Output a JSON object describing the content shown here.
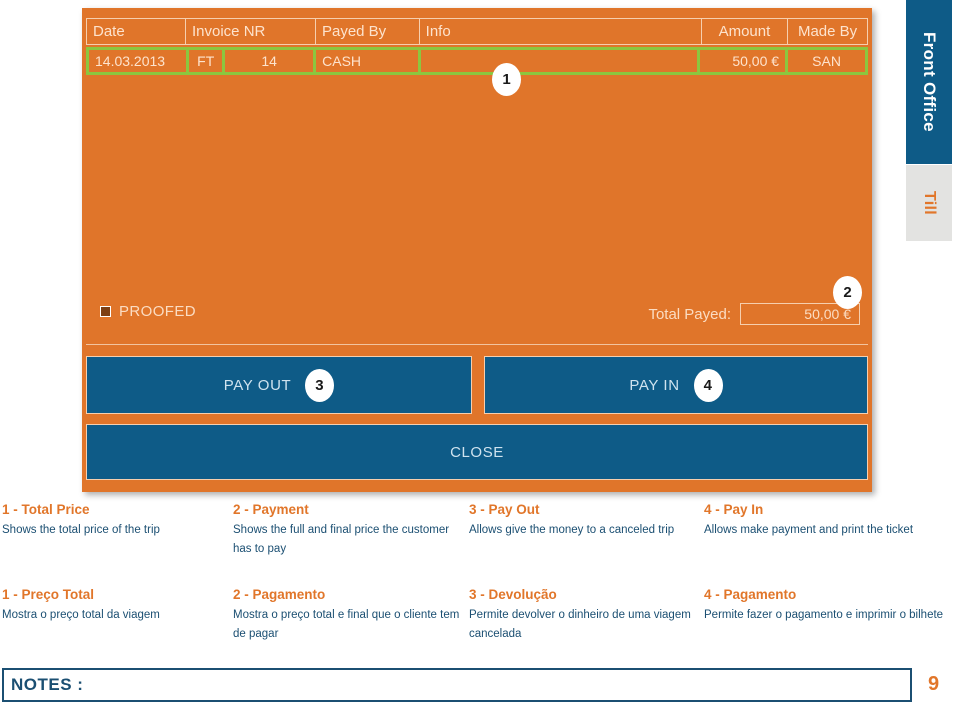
{
  "side_tabs": [
    {
      "label": "Front Office",
      "state": "active"
    },
    {
      "label": "Till",
      "state": "inactive"
    }
  ],
  "app": {
    "table": {
      "columns": [
        {
          "key": "date",
          "label": "Date"
        },
        {
          "key": "invoice",
          "label": "Invoice NR"
        },
        {
          "key": "payed_by",
          "label": "Payed By"
        },
        {
          "key": "info",
          "label": "Info"
        },
        {
          "key": "amount",
          "label": "Amount"
        },
        {
          "key": "made_by",
          "label": "Made By"
        }
      ],
      "rows": [
        {
          "date": "14.03.2013",
          "invoice_type": "FT",
          "invoice_nr": "14",
          "payed_by": "CASH",
          "info": "",
          "amount": "50,00 €",
          "made_by": "SAN"
        }
      ]
    },
    "proofed_label": "PROOFED",
    "total_payed_label": "Total Payed:",
    "total_payed_value": "50,00 €",
    "buttons": {
      "pay_out": "PAY OUT",
      "pay_in": "PAY IN",
      "close": "CLOSE"
    },
    "badges": {
      "total_price": "1",
      "payment": "2",
      "pay_out": "3",
      "pay_in": "4"
    }
  },
  "captions_en": [
    {
      "title": "1 - Total Price",
      "text": "Shows the total price of the trip"
    },
    {
      "title": "2 -  Payment",
      "text": "Shows the full and final price the customer has to pay"
    },
    {
      "title": "3 - Pay Out",
      "text": "Allows give the money to a canceled trip"
    },
    {
      "title": "4 - Pay In",
      "text": "Allows make payment and print the ticket"
    }
  ],
  "captions_pt": [
    {
      "title": "1 - Preço Total",
      "text": "Mostra o preço total da viagem"
    },
    {
      "title": "2 - Pagamento",
      "text": "Mostra o preço total e final que o cliente tem de pagar"
    },
    {
      "title": "3 - Devolução",
      "text": "Permite devolver o dinheiro de uma viagem cancelada"
    },
    {
      "title": "4 - Pagamento",
      "text": "Permite fazer o pagamento e imprimir o bilhete"
    }
  ],
  "footer": {
    "notes_label": "NOTES :",
    "page_number": "9"
  },
  "colors": {
    "orange": "#e0752a",
    "blue": "#0e5b87",
    "green_highlight": "#8cc63f",
    "caption_title": "#e1762a",
    "caption_text": "#1b4f72"
  }
}
